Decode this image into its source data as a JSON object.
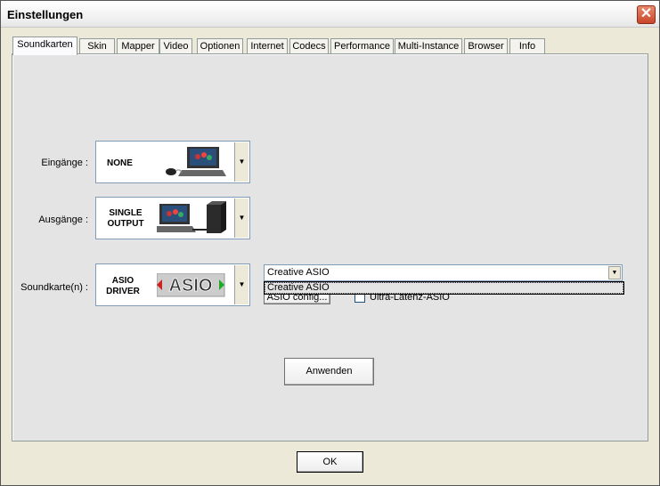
{
  "window": {
    "title": "Einstellungen",
    "close_symbol": "✕"
  },
  "tabs": [
    {
      "label": "Soundkarten",
      "active": true
    },
    {
      "label": "Skin"
    },
    {
      "label": "Mapper"
    },
    {
      "label": "Video"
    },
    {
      "label": "Optionen"
    },
    {
      "label": "Internet"
    },
    {
      "label": "Codecs"
    },
    {
      "label": "Performance"
    },
    {
      "label": "Multi-Instance"
    },
    {
      "label": "Browser"
    },
    {
      "label": "Info"
    }
  ],
  "inputs": {
    "label": "Eingänge :",
    "value": "NONE"
  },
  "outputs": {
    "label": "Ausgänge :",
    "value_line1": "SINGLE",
    "value_line2": "OUTPUT"
  },
  "soundcard": {
    "label": "Soundkarte(n) :",
    "value_line1": "ASIO",
    "value_line2": "DRIVER",
    "logo_text": "ASIO",
    "device_select": {
      "value": "Creative ASIO",
      "options": [
        "Creative ASIO"
      ]
    },
    "config_button": "ASIO config...",
    "low_latency_label": "Ultra-Latenz-ASIO"
  },
  "buttons": {
    "apply": "Anwenden",
    "ok": "OK"
  },
  "icons": {
    "dropdown": "▼"
  }
}
